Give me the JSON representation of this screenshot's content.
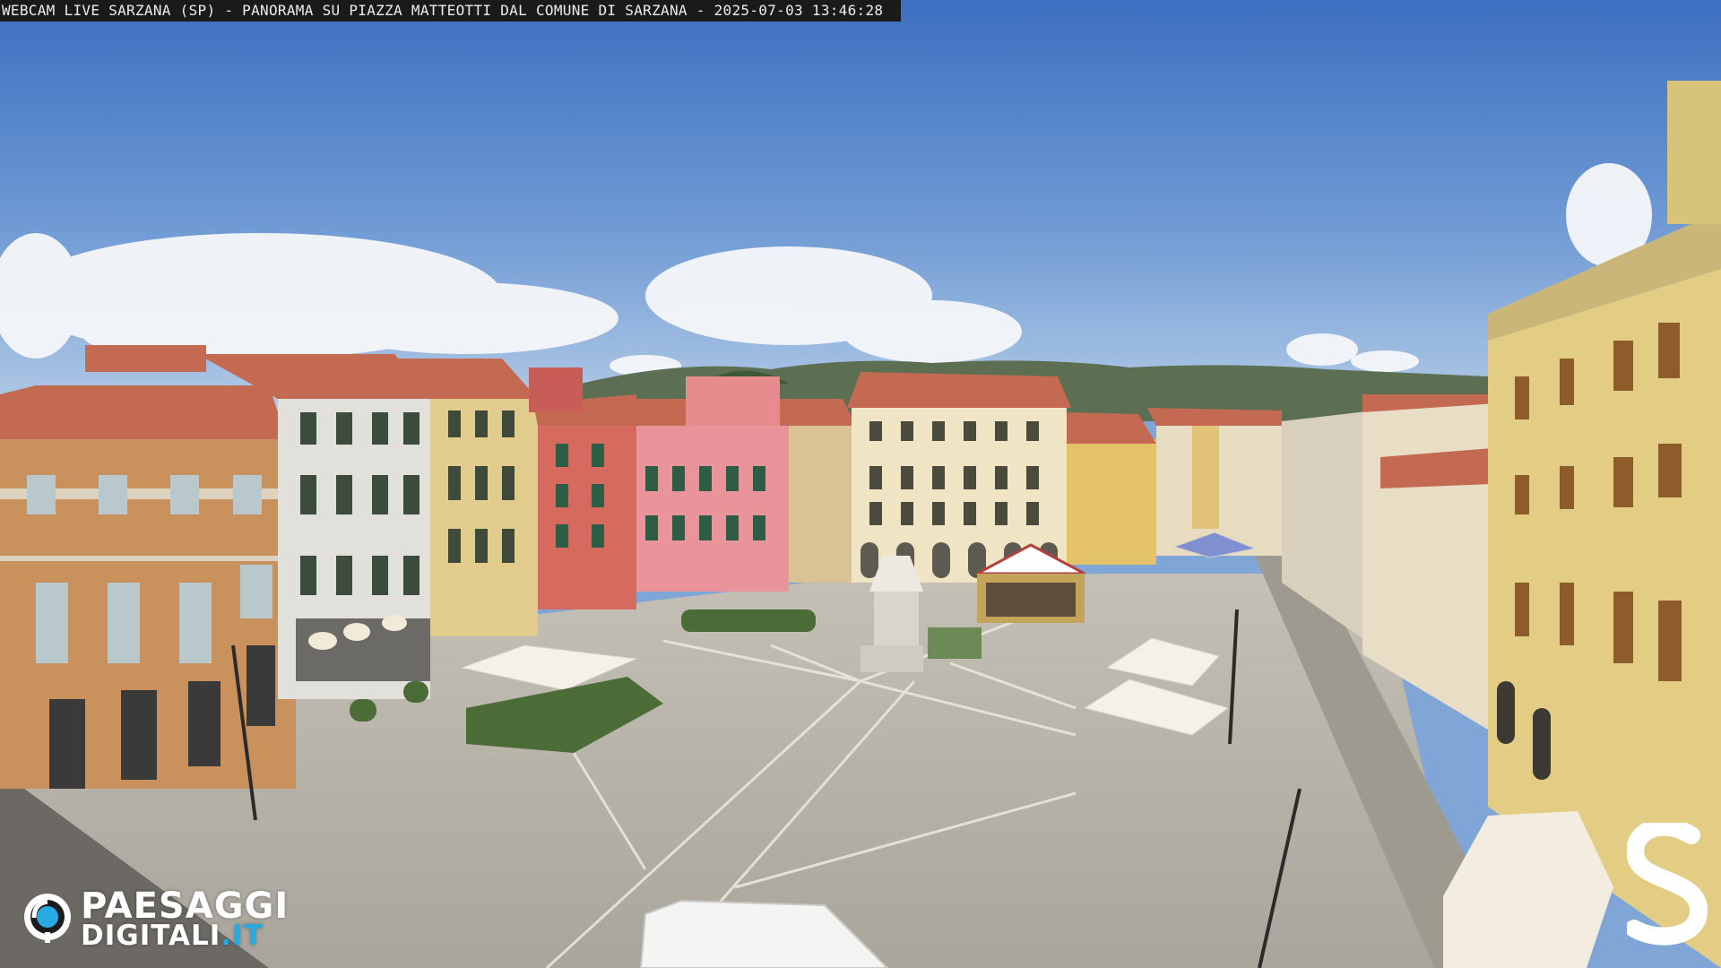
{
  "caption": {
    "text": "WEBCAM LIVE SARZANA (SP) - PANORAMA SU PIAZZA MATTEOTTI DAL COMUNE DI SARZANA - 2025-07-03   13:46:28"
  },
  "logo": {
    "line1": "PAESAGGI",
    "line2": "DIGITALI",
    "tld": ".IT",
    "accent_color": "#29a9e1",
    "icon": "eye-icon"
  },
  "brand_mark": {
    "letter": "S"
  },
  "colors": {
    "sky_top": "#3f72c2",
    "sky_bottom": "#a9c6e6",
    "pavement": "#b7b3aa",
    "roof": "#c46a52"
  }
}
